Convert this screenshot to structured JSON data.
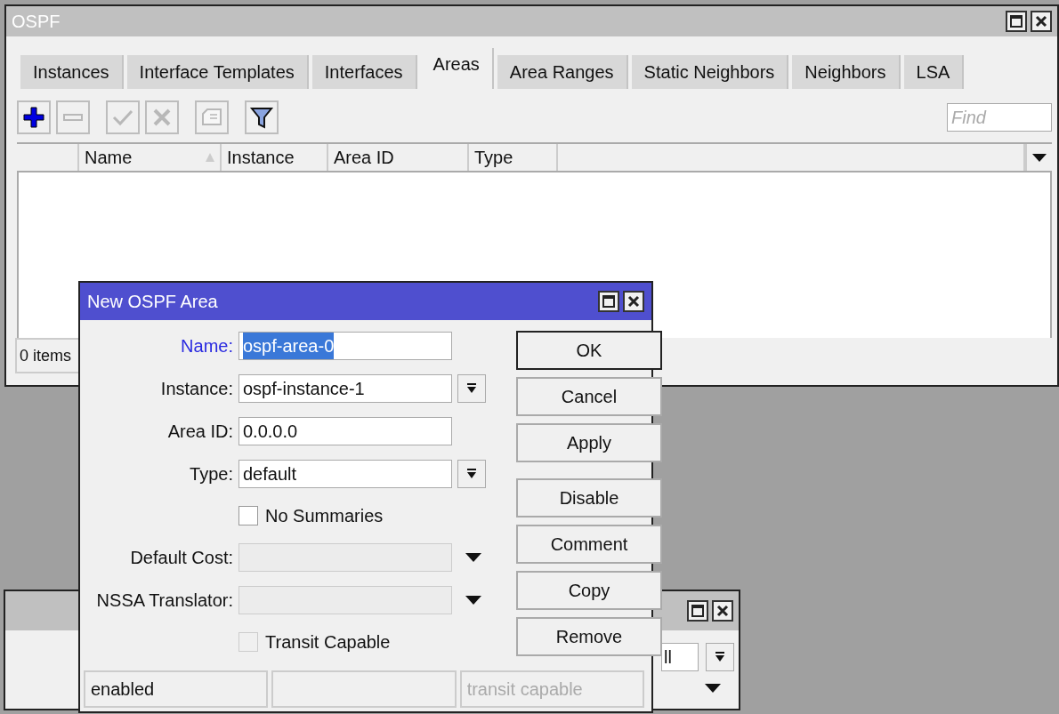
{
  "main_window": {
    "title": "OSPF",
    "tabs": [
      {
        "label": "Instances",
        "selected": false
      },
      {
        "label": "Interface Templates",
        "selected": false
      },
      {
        "label": "Interfaces",
        "selected": false
      },
      {
        "label": "Areas",
        "selected": true
      },
      {
        "label": "Area Ranges",
        "selected": false
      },
      {
        "label": "Static Neighbors",
        "selected": false
      },
      {
        "label": "Neighbors",
        "selected": false
      },
      {
        "label": "LSA",
        "selected": false
      }
    ],
    "toolbar": [
      {
        "kind": "add",
        "disabled": false
      },
      {
        "kind": "remove",
        "disabled": true
      },
      {
        "kind": "enable",
        "disabled": true
      },
      {
        "kind": "disable",
        "disabled": true
      },
      {
        "kind": "comment",
        "disabled": true
      },
      {
        "kind": "filter",
        "disabled": false
      }
    ],
    "find": {
      "placeholder": "Find"
    },
    "columns": [
      {
        "label": "Name",
        "sorted": true
      },
      {
        "label": "Instance",
        "sorted": false
      },
      {
        "label": "Area ID",
        "sorted": false
      },
      {
        "label": "Type",
        "sorted": false
      }
    ],
    "status": "0 items"
  },
  "back_window": {
    "field_value": "ll"
  },
  "dialog": {
    "title": "New OSPF Area",
    "fields": [
      {
        "kind": "text",
        "label": "Name:",
        "value": "ospf-area-0",
        "focused": true
      },
      {
        "kind": "select",
        "label": "Instance:",
        "value": "ospf-instance-1",
        "focused": false
      },
      {
        "kind": "text",
        "label": "Area ID:",
        "value": "0.0.0.0",
        "focused": false
      },
      {
        "kind": "select",
        "label": "Type:",
        "value": "default",
        "focused": false
      },
      {
        "kind": "checkbox",
        "label": "No Summaries",
        "checked": false,
        "disabled": false
      },
      {
        "kind": "combo",
        "label": "Default Cost:",
        "disabled": true
      },
      {
        "kind": "combo",
        "label": "NSSA Translator:",
        "disabled": true
      },
      {
        "kind": "checkbox",
        "label": "Transit Capable",
        "checked": false,
        "disabled": true
      }
    ],
    "button_groups": [
      [
        {
          "label": "OK",
          "default": true
        },
        {
          "label": "Cancel",
          "default": false
        },
        {
          "label": "Apply",
          "default": false
        }
      ],
      [
        {
          "label": "Disable",
          "default": false
        },
        {
          "label": "Comment",
          "default": false
        },
        {
          "label": "Copy",
          "default": false
        },
        {
          "label": "Remove",
          "default": false
        }
      ]
    ],
    "status_bar": [
      {
        "text": "enabled",
        "disabled": false
      },
      {
        "text": "transit capable",
        "disabled": true
      }
    ]
  }
}
